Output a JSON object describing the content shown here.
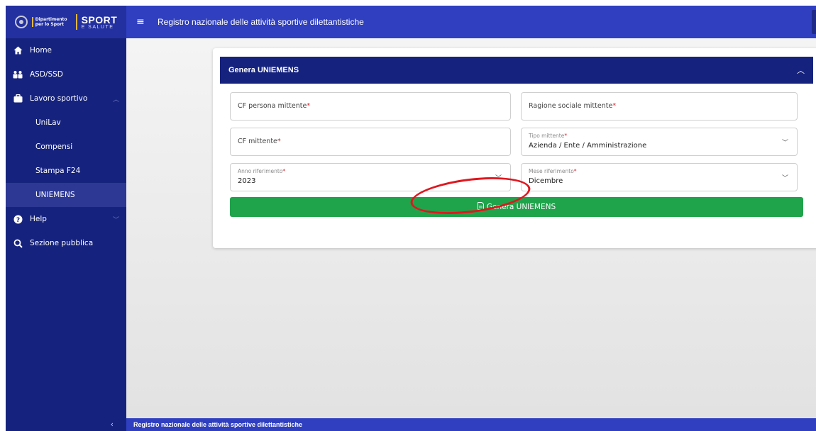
{
  "sidebar": {
    "logo": {
      "dept_text": "Dipartimento\nper lo Sport",
      "sport_main": "SPORT",
      "sport_sub": "E SALUTE"
    },
    "items": [
      {
        "label": "Home",
        "icon": "home-icon"
      },
      {
        "label": "ASD/SSD",
        "icon": "people-icon"
      },
      {
        "label": "Lavoro sportivo",
        "icon": "briefcase-icon",
        "expanded": true,
        "children": [
          {
            "label": "UniLav"
          },
          {
            "label": "Compensi"
          },
          {
            "label": "Stampa F24"
          },
          {
            "label": "UNIEMENS",
            "active": true
          }
        ]
      },
      {
        "label": "Help",
        "icon": "help-icon",
        "expanded": false
      },
      {
        "label": "Sezione pubblica",
        "icon": "search-icon"
      }
    ],
    "collapse_glyph": "‹"
  },
  "header": {
    "title": "Registro nazionale delle attività sportive dilettantistiche"
  },
  "card": {
    "title": "Genera UNIEMENS",
    "fields": {
      "cf_persona": {
        "placeholder": "CF persona mittente",
        "required": "*"
      },
      "ragione_sociale": {
        "placeholder": "Ragione sociale mittente",
        "required": "*"
      },
      "cf_mittente": {
        "placeholder": "CF mittente",
        "required": "*"
      },
      "tipo_mittente": {
        "label": "Tipo mittente",
        "required": "*",
        "value": "Azienda / Ente / Amministrazione"
      },
      "anno": {
        "label": "Anno riferimento",
        "required": "*",
        "value": "2023"
      },
      "mese": {
        "label": "Mese riferimento",
        "required": "*",
        "value": "Dicembre"
      }
    },
    "button_label": "Genera UNIEMENS"
  },
  "footer": {
    "text": "Registro nazionale delle attività sportive dilettantistiche"
  },
  "colors": {
    "sidebar": "#16237e",
    "header": "#2f3fc0",
    "button": "#1fa34b",
    "annotation": "#e0171f"
  }
}
